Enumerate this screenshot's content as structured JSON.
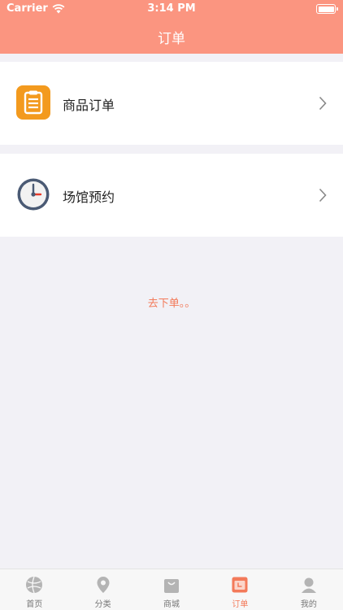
{
  "status_bar": {
    "carrier": "Carrier",
    "time": "3:14 PM"
  },
  "header": {
    "title": "订单"
  },
  "rows": [
    {
      "label": "商品订单",
      "icon": "clipboard-icon"
    },
    {
      "label": "场馆预约",
      "icon": "clock-icon"
    }
  ],
  "empty_text": "去下单。。",
  "tabbar": {
    "items": [
      {
        "label": "首页",
        "icon": "ball-icon"
      },
      {
        "label": "分类",
        "icon": "location-pin-icon"
      },
      {
        "label": "商城",
        "icon": "shopping-bag-icon"
      },
      {
        "label": "订单",
        "icon": "order-icon",
        "active": true
      },
      {
        "label": "我的",
        "icon": "user-icon"
      }
    ]
  },
  "colors": {
    "accent": "#fb9580",
    "highlight": "#f37a5a",
    "icon_orange": "#f39a1e",
    "clock_blue": "#4a5a74"
  }
}
